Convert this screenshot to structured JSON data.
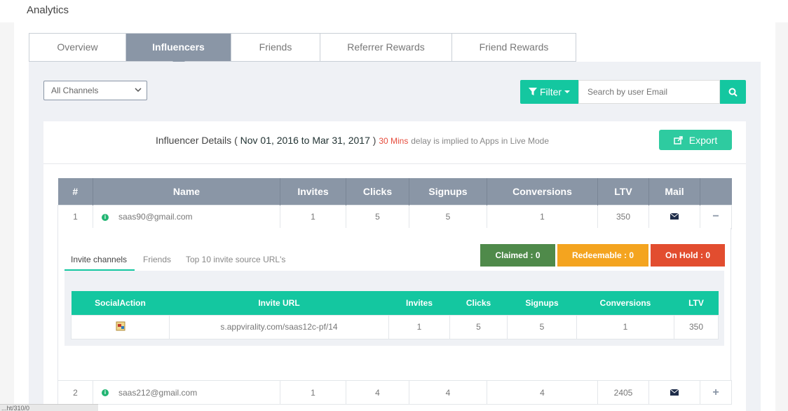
{
  "page": {
    "title": "Analytics"
  },
  "tabs": [
    {
      "label": "Overview",
      "active": false
    },
    {
      "label": "Influencers",
      "active": true
    },
    {
      "label": "Friends",
      "active": false
    },
    {
      "label": "Referrer Rewards",
      "active": false
    },
    {
      "label": "Friend Rewards",
      "active": false
    }
  ],
  "controls": {
    "channel_select": "All Channels",
    "filter_label": "Filter",
    "search_placeholder": "Search by user Email"
  },
  "details": {
    "prefix": "Influencer Details",
    "range": "Nov 01, 2016 to Mar 31, 2017",
    "delay": "30 Mins",
    "note": "delay is implied to Apps in Live Mode",
    "export_label": "Export"
  },
  "table": {
    "headers": [
      "#",
      "Name",
      "Invites",
      "Clicks",
      "Signups",
      "Conversions",
      "LTV",
      "Mail",
      ""
    ],
    "rows": [
      {
        "num": "1",
        "email": "saas90@gmail.com",
        "invites": "1",
        "clicks": "5",
        "signups": "5",
        "conversions": "1",
        "ltv": "350",
        "toggle": "−"
      },
      {
        "num": "2",
        "email": "saas212@gmail.com",
        "invites": "1",
        "clicks": "4",
        "signups": "4",
        "conversions": "4",
        "ltv": "2405",
        "toggle": "+"
      }
    ]
  },
  "expanded": {
    "subtabs": [
      "Invite channels",
      "Friends",
      "Top 10 invite source URL's"
    ],
    "badges": [
      {
        "label": "Claimed :  0",
        "color": "#4f8a4a"
      },
      {
        "label": "Redeemable :  0",
        "color": "#f4a41f"
      },
      {
        "label": "On Hold :  0",
        "color": "#e24d2f"
      }
    ],
    "inner_headers": [
      "SocialAction",
      "Invite URL",
      "Invites",
      "Clicks",
      "Signups",
      "Conversions",
      "LTV"
    ],
    "inner_rows": [
      {
        "url": "s.appvirality.com/saas12c-pf/14",
        "invites": "1",
        "clicks": "5",
        "signups": "5",
        "conversions": "1",
        "ltv": "350"
      }
    ]
  },
  "statusbar": {
    "text": "...ht/310/0"
  },
  "colors": {
    "accent": "#14c7a0",
    "tab_active": "#8a96a6",
    "delay_red": "#e64c3c"
  }
}
